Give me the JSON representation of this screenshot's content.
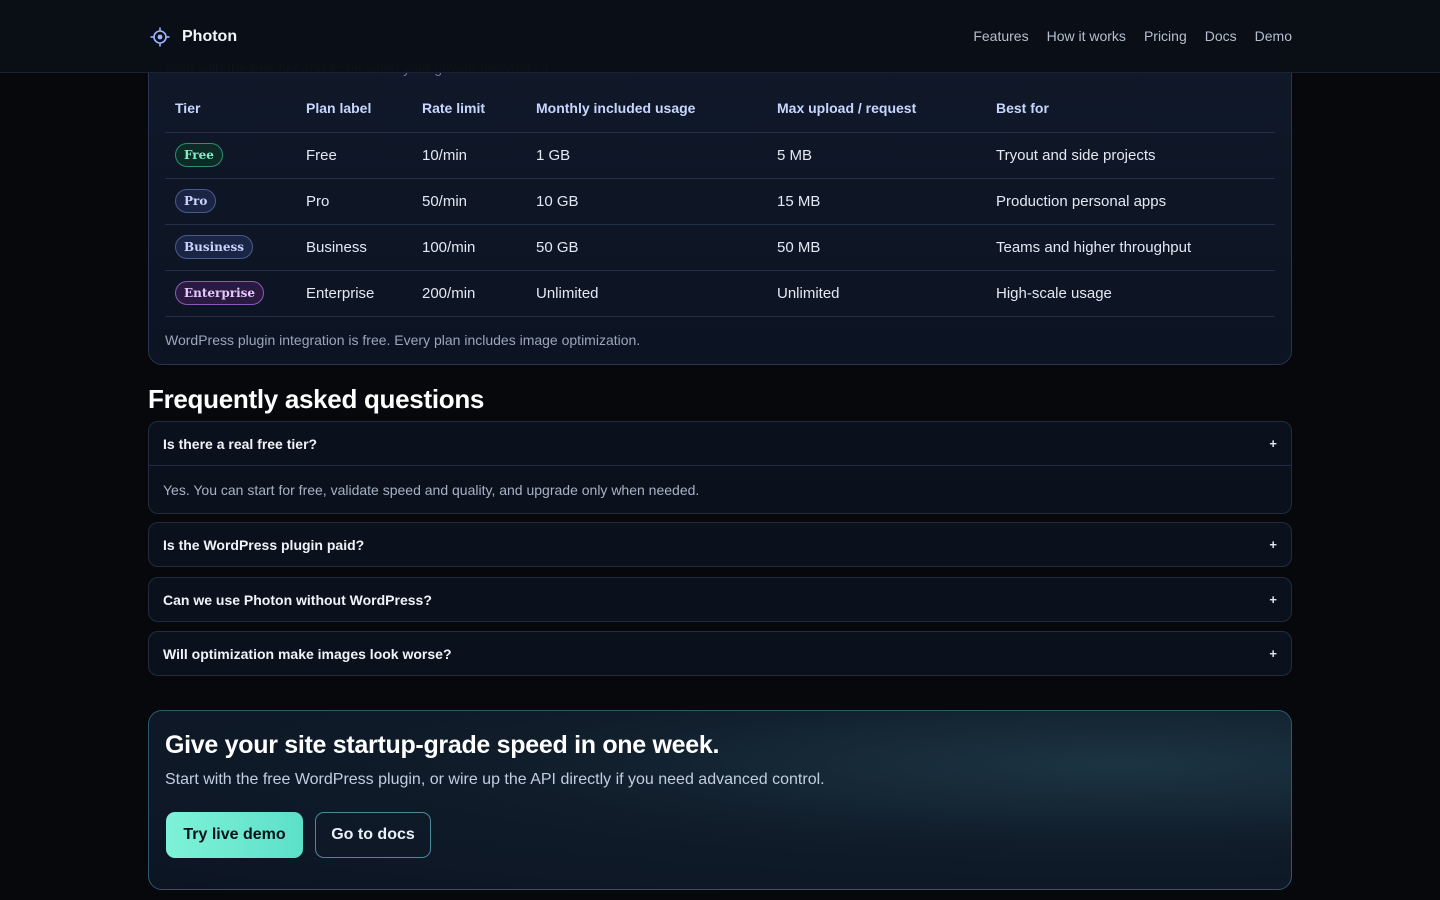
{
  "header": {
    "brand": "Photon",
    "nav": [
      "Features",
      "How it works",
      "Pricing",
      "Docs",
      "Demo"
    ]
  },
  "pricing": {
    "subtitle": "Start with the free tier and scale when your growth demands it.",
    "columns": [
      "Tier",
      "Plan label",
      "Rate limit",
      "Monthly included usage",
      "Max upload / request",
      "Best for"
    ],
    "rows": [
      {
        "tier": "Free",
        "plan": "Free",
        "rate": "10/min",
        "usage": "1 GB",
        "upload": "5 MB",
        "best": "Tryout and side projects"
      },
      {
        "tier": "Pro",
        "plan": "Pro",
        "rate": "50/min",
        "usage": "10 GB",
        "upload": "15 MB",
        "best": "Production personal apps"
      },
      {
        "tier": "Business",
        "plan": "Business",
        "rate": "100/min",
        "usage": "50 GB",
        "upload": "50 MB",
        "best": "Teams and higher throughput"
      },
      {
        "tier": "Enterprise",
        "plan": "Enterprise",
        "rate": "200/min",
        "usage": "Unlimited",
        "upload": "Unlimited",
        "best": "High-scale usage"
      }
    ],
    "note": "WordPress plugin integration is free. Every plan includes image optimization."
  },
  "faq": {
    "title": "Frequently asked questions",
    "items": [
      {
        "q": "Is there a real free tier?",
        "a": "Yes. You can start for free, validate speed and quality, and upgrade only when needed.",
        "toggle": "+"
      },
      {
        "q": "Is the WordPress plugin paid?",
        "toggle": "+"
      },
      {
        "q": "Can we use Photon without WordPress?",
        "toggle": "+"
      },
      {
        "q": "Will optimization make images look worse?",
        "toggle": "+"
      }
    ]
  },
  "cta": {
    "title": "Give your site startup-grade speed in one week.",
    "subtitle": "Start with the free WordPress plugin, or wire up the API directly if you need advanced control.",
    "primary": "Try live demo",
    "secondary": "Go to docs"
  }
}
